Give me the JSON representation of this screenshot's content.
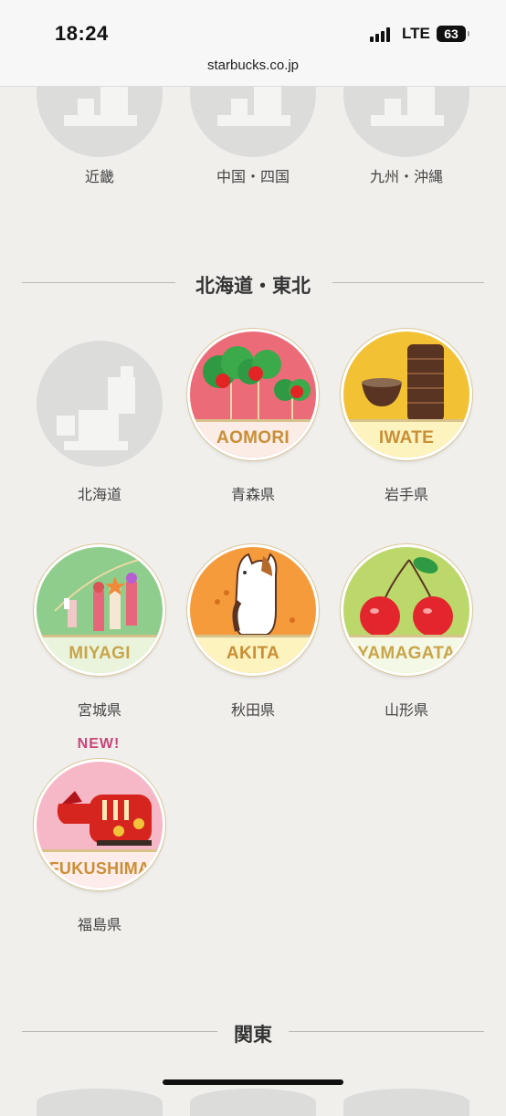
{
  "status_bar": {
    "time": "18:24",
    "network": "LTE",
    "battery": "63"
  },
  "browser": {
    "url": "starbucks.co.jp"
  },
  "prev_row": {
    "labels": [
      "近畿",
      "中国・四国",
      "九州・沖縄"
    ]
  },
  "section": {
    "title": "北海道・東北",
    "items": [
      {
        "label": "北海道",
        "pin": ""
      },
      {
        "label": "青森県",
        "pin": "AOMORI"
      },
      {
        "label": "岩手県",
        "pin": "IWATE"
      },
      {
        "label": "宮城県",
        "pin": "MIYAGI"
      },
      {
        "label": "秋田県",
        "pin": "AKITA"
      },
      {
        "label": "山形県",
        "pin": "YAMAGATA"
      },
      {
        "label": "福島県",
        "pin": "FUKUSHIMA",
        "badge": "NEW!"
      }
    ]
  },
  "next_section": {
    "title": "関東"
  },
  "colors": {
    "aomori_bg": "#ec6b78",
    "iwate_bg": "#f3c234",
    "miyagi_bg": "#8fcd8c",
    "akita_bg": "#f59b3c",
    "yamagata_bg": "#bcd86b",
    "fukushima_bg": "#f6b7c6",
    "new_badge": "#c8467a",
    "placeholder": "#dcdcdb"
  }
}
